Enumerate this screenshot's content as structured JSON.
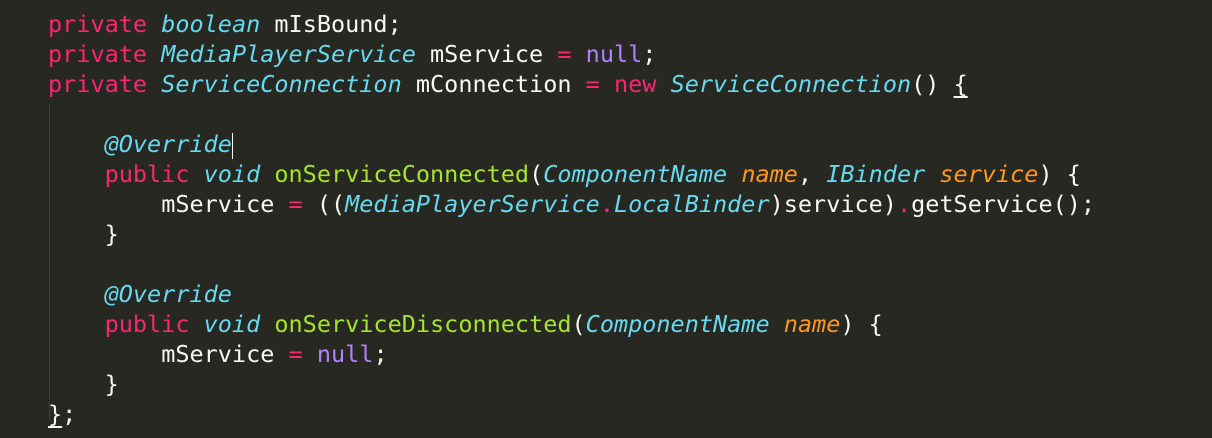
{
  "code": {
    "line1": {
      "kw": "private",
      "type": "boolean",
      "rest": " mIsBound;"
    },
    "line2": {
      "kw": "private",
      "type": "MediaPlayerService",
      "ident": " mService ",
      "op": "=",
      "space": " ",
      "nul": "null",
      "semi": ";"
    },
    "line3": {
      "kw": "private",
      "type": "ServiceConnection",
      "ident": " mConnection ",
      "op": "=",
      "space": " ",
      "new": "new",
      "space2": " ",
      "type2": "ServiceConnection",
      "parens": "() ",
      "brace": "{"
    },
    "line5": {
      "indent": "    ",
      "annotation": "@Override"
    },
    "line6": {
      "indent": "    ",
      "kw": "public",
      "space": " ",
      "type": "void",
      "space2": " ",
      "fn": "onServiceConnected",
      "open": "(",
      "ptype1": "ComponentName",
      "space3": " ",
      "param1": "name",
      "comma": ", ",
      "ptype2": "IBinder",
      "space4": " ",
      "param2": "service",
      "close": ") {"
    },
    "line7": {
      "indent": "        ",
      "ident": "mService ",
      "op": "=",
      "open": " ((",
      "type1": "MediaPlayerService",
      "dot": ".",
      "type2": "LocalBinder",
      "cast": ")service)",
      "dot2": ".",
      "call": "getService();"
    },
    "line8": {
      "indent": "    ",
      "brace": "}"
    },
    "line10": {
      "indent": "    ",
      "annotation": "@Override"
    },
    "line11": {
      "indent": "    ",
      "kw": "public",
      "space": " ",
      "type": "void",
      "space2": " ",
      "fn": "onServiceDisconnected",
      "open": "(",
      "ptype": "ComponentName",
      "space3": " ",
      "param": "name",
      "close": ") {"
    },
    "line12": {
      "indent": "        ",
      "ident": "mService ",
      "op": "=",
      "space": " ",
      "nul": "null",
      "semi": ";"
    },
    "line13": {
      "indent": "    ",
      "brace": "}"
    },
    "line14": {
      "brace": "}",
      "semi": ";"
    }
  }
}
